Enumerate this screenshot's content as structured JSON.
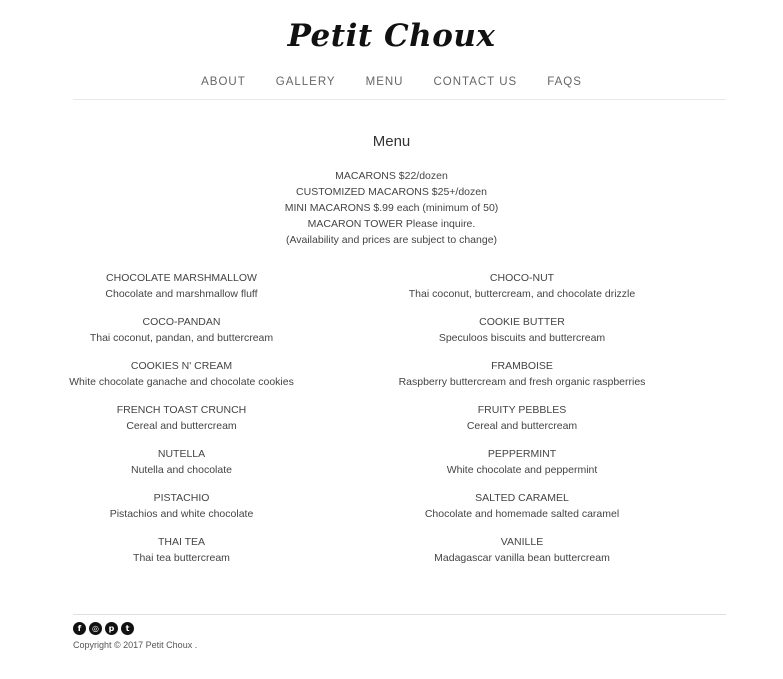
{
  "header": {
    "logo": "Petit Choux"
  },
  "nav": [
    "ABOUT",
    "GALLERY",
    "MENU",
    "CONTACT US",
    "FAQS"
  ],
  "menu": {
    "title": "Menu",
    "prices": [
      "MACARONS $22/dozen",
      "CUSTOMIZED MACARONS $25+/dozen",
      "MINI MACARONS $.99 each (minimum of 50)",
      "MACARON TOWER Please inquire.",
      "(Availability and prices are subject to change)"
    ],
    "flavors": [
      {
        "name": "CHOCOLATE MARSHMALLOW",
        "desc": "Chocolate and marshmallow fluff"
      },
      {
        "name": "CHOCO-NUT",
        "desc": "Thai coconut, buttercream, and chocolate drizzle"
      },
      {
        "name": "COCO-PANDAN",
        "desc": "Thai coconut, pandan, and buttercream"
      },
      {
        "name": "COOKIE BUTTER",
        "desc": "Speculoos biscuits and buttercream"
      },
      {
        "name": "COOKIES N' CREAM",
        "desc": "White chocolate ganache and chocolate cookies"
      },
      {
        "name": "FRAMBOISE",
        "desc": "Raspberry buttercream and fresh organic raspberries"
      },
      {
        "name": "FRENCH TOAST CRUNCH",
        "desc": "Cereal and buttercream"
      },
      {
        "name": "FRUITY PEBBLES",
        "desc": "Cereal and buttercream"
      },
      {
        "name": "NUTELLA",
        "desc": "Nutella and chocolate"
      },
      {
        "name": "PEPPERMINT",
        "desc": "White chocolate and peppermint"
      },
      {
        "name": "PISTACHIO",
        "desc": "Pistachios and white chocolate"
      },
      {
        "name": "SALTED CARAMEL",
        "desc": "Chocolate and homemade salted caramel"
      },
      {
        "name": "THAI TEA",
        "desc": "Thai tea buttercream"
      },
      {
        "name": "VANILLE",
        "desc": "Madagascar vanilla bean buttercream"
      }
    ]
  },
  "footer": {
    "social_icons": [
      "facebook-icon",
      "instagram-icon",
      "pinterest-icon",
      "twitter-icon"
    ],
    "copyright": "Copyright © 2017 Petit Choux ."
  }
}
